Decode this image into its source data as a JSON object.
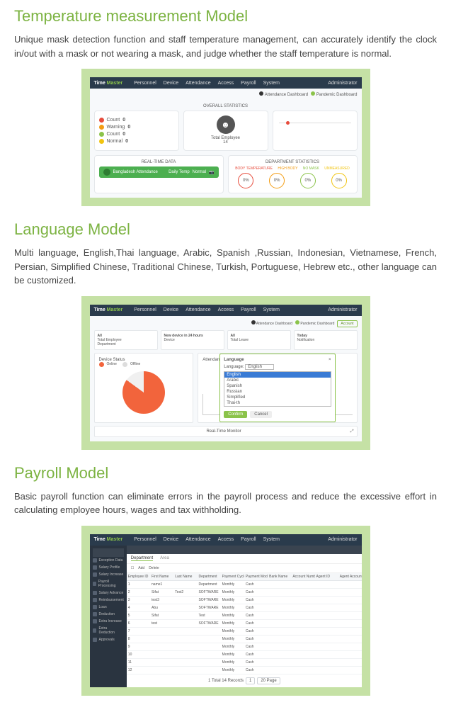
{
  "sections": {
    "s1": {
      "title": "Temperature measurement Model",
      "desc": "Unique mask detection function and staff temperature management, can accurately identify the clock in/out with a mask or not wearing a mask, and judge whether the staff temperature is normal."
    },
    "s2": {
      "title": "Language Model",
      "desc": "Multi language, English,Thai language, Arabic, Spanish ,Russian, Indonesian, Vietnamese, French, Persian, Simplified Chinese, Traditional Chinese, Turkish, Portuguese, Hebrew etc., other language can be customized."
    },
    "s3": {
      "title": "Payroll Model",
      "desc": "Basic payroll function can eliminate errors in the payroll process and reduce the excessive effort in calculating employee hours, wages and tax withholding."
    }
  },
  "app": {
    "brand_prefix": "Time",
    "brand_suffix": "Master",
    "nav": [
      "Personnel",
      "Device",
      "Attendance",
      "Access",
      "Payroll",
      "System"
    ],
    "admin": "Administrator"
  },
  "shot1": {
    "attendance_mode": "Attendance Dashboard",
    "temp_mode": "Pandemic Dashboard",
    "overall_title": "OVERALL STATISTICS",
    "stats": [
      "Count",
      "Warning",
      "Count",
      "Normal"
    ],
    "dots": [
      "#e74c3c",
      "#f39c12",
      "#8bc34a",
      "#f1c40f"
    ],
    "total_emp": "Total Employee",
    "total_emp_n": "14",
    "realtime_title": "REAL-TIME DATA",
    "dept_title": "DEPARTMENT STATISTICS",
    "dept_labels": [
      "BODY TEMPERATURE",
      "HIGH BODY",
      "NO MASK",
      "UNMEASURED"
    ],
    "gauge_val": "0%",
    "emp_name": "Bangladesh Attendance",
    "emp_dept": "Daily Temp",
    "emp_time": "Normal"
  },
  "shot2": {
    "cards": [
      "All",
      "New device in 24 hours",
      "All",
      "Today"
    ],
    "card_sub": [
      "Total Employee",
      "Device",
      "Total Leave",
      "Notification"
    ],
    "card_sub2": [
      "Department",
      "",
      "",
      ""
    ],
    "device_title": "Device Status",
    "device_legend": [
      "Online",
      "Offline"
    ],
    "attend_title": "Attendance",
    "modal_title": "Language",
    "modal_field": "Language:",
    "lang_selected": "English",
    "lang_opts": [
      "English",
      "Arabic",
      "Spanish",
      "Russian",
      "Simplified",
      "Thai-th"
    ],
    "btn_confirm": "Confirm",
    "btn_cancel": "Cancel",
    "acct_btn": "Account",
    "realtime_title": "Real-Time Monitor"
  },
  "shot3": {
    "sidebar": [
      "Exception Data",
      "Salary Profile",
      "Salary Increase",
      "Payroll Processing",
      "Salary Advance",
      "Reimbursement",
      "Loan",
      "Deduction",
      "Extra Increase",
      "Extra Deduction",
      "Approvals"
    ],
    "tabs": [
      "Department",
      "Area"
    ],
    "subbar_items": [
      "Add",
      "Delete"
    ],
    "columns": [
      "Employee ID",
      "First Name",
      "Last Name",
      "Department",
      "Payment Cycle",
      "Payment Mode",
      "Bank Name",
      "Account Number",
      "Agent ID",
      "Agent Account ID"
    ],
    "cycle": "Monthly",
    "mode": "Cash",
    "rows": [
      [
        "1",
        "name1",
        "",
        "Department",
        "Monthly",
        "Cash",
        "",
        "",
        "",
        ""
      ],
      [
        "2",
        "Sifat",
        "Test2",
        "SOFTWARE",
        "Monthly",
        "Cash",
        "",
        "",
        "",
        ""
      ],
      [
        "3",
        "test3",
        "",
        "SOFTWARE",
        "Monthly",
        "Cash",
        "",
        "",
        "",
        ""
      ],
      [
        "4",
        "Abu",
        "",
        "SOFTWARE",
        "Monthly",
        "Cash",
        "",
        "",
        "",
        ""
      ],
      [
        "5",
        "Sifat",
        "",
        "Test",
        "Monthly",
        "Cash",
        "",
        "",
        "",
        ""
      ],
      [
        "6",
        "test",
        "",
        "SOFTWARE",
        "Monthly",
        "Cash",
        "",
        "",
        "",
        ""
      ],
      [
        "7",
        "",
        "",
        "",
        "Monthly",
        "Cash",
        "",
        "",
        "",
        ""
      ],
      [
        "8",
        "",
        "",
        "",
        "Monthly",
        "Cash",
        "",
        "",
        "",
        ""
      ],
      [
        "9",
        "",
        "",
        "",
        "Monthly",
        "Cash",
        "",
        "",
        "",
        ""
      ],
      [
        "10",
        "",
        "",
        "",
        "Monthly",
        "Cash",
        "",
        "",
        "",
        ""
      ],
      [
        "11",
        "",
        "",
        "",
        "Monthly",
        "Cash",
        "",
        "",
        "",
        ""
      ],
      [
        "12",
        "",
        "",
        "",
        "Monthly",
        "Cash",
        "",
        "",
        "",
        ""
      ]
    ],
    "pager": [
      "1 Total 14 Records",
      "1",
      "20 Page"
    ]
  }
}
